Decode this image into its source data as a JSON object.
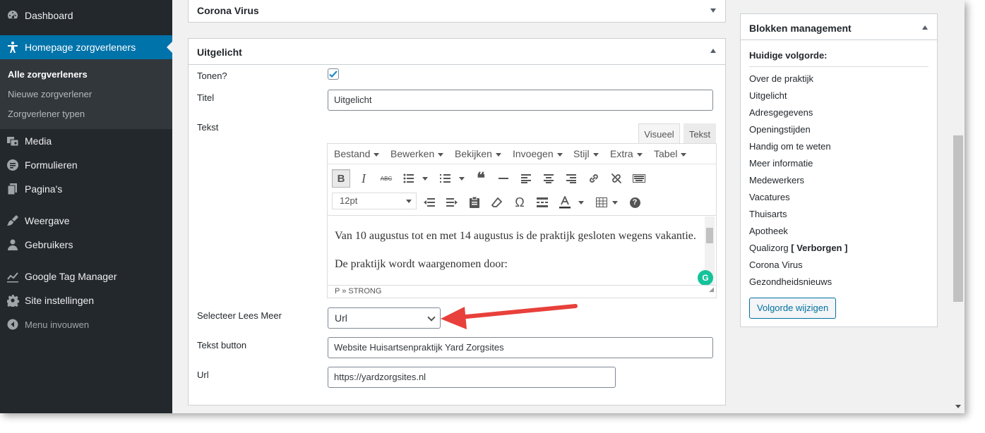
{
  "sidebar": {
    "items": [
      {
        "label": "Dashboard",
        "icon": "dashboard-icon"
      },
      {
        "label": "Homepage zorgverleners",
        "icon": "accessibility-icon"
      },
      {
        "label": "Media",
        "icon": "media-icon"
      },
      {
        "label": "Formulieren",
        "icon": "forms-icon"
      },
      {
        "label": "Pagina's",
        "icon": "pages-icon"
      },
      {
        "label": "Weergave",
        "icon": "appearance-icon"
      },
      {
        "label": "Gebruikers",
        "icon": "users-icon"
      },
      {
        "label": "Google Tag Manager",
        "icon": "chart-icon"
      },
      {
        "label": "Site instellingen",
        "icon": "gear-icon"
      }
    ],
    "submenu": [
      "Alle zorgverleners",
      "Nieuwe zorgverlener",
      "Zorgverlener typen"
    ],
    "collapse_label": "Menu invouwen"
  },
  "boxes": {
    "corona_title": "Corona Virus",
    "featured_title": "Uitgelicht"
  },
  "form": {
    "show_label": "Tonen?",
    "show_checked": true,
    "title_label": "Titel",
    "title_value": "Uitgelicht",
    "text_label": "Tekst",
    "read_more_label": "Selecteer Lees Meer",
    "read_more_value": "Url",
    "button_text_label": "Tekst button",
    "button_text_value": "Website Huisartsenpraktijk Yard Zorgsites",
    "url_label": "Url",
    "url_value": "https://yardzorgsites.nl"
  },
  "editor": {
    "tab_visual": "Visueel",
    "tab_text": "Tekst",
    "menu": [
      "Bestand",
      "Bewerken",
      "Bekijken",
      "Invoegen",
      "Stijl",
      "Extra",
      "Tabel"
    ],
    "bold_glyph": "B",
    "italic_glyph": "I",
    "strike_glyph": "ABC",
    "quote_glyph": "❝",
    "omega_glyph": "Ω",
    "help_glyph": "?",
    "font_size": "12pt",
    "paragraphs": [
      "Van 10 augustus tot en met 14 augustus is de praktijk gesloten wegens vakantie.",
      "De praktijk wordt waargenomen door:"
    ],
    "status_path": "P » STRONG",
    "grammarly_glyph": "G"
  },
  "blocks": {
    "title": "Blokken management",
    "heading": "Huidige volgorde:",
    "items": [
      "Over de praktijk",
      "Uitgelicht",
      "Adresgegevens",
      "Openingstijden",
      "Handig om te weten",
      "Meer informatie",
      "Medewerkers",
      "Vacatures",
      "Thuisarts",
      "Apotheek",
      "Qualizorg",
      "Corona Virus",
      "Gezondheidsnieuws"
    ],
    "hidden_item_suffix": "[ Verborgen ]",
    "button_label": "Volgorde wijzigen"
  },
  "colors": {
    "sidebar_bg": "#23282d",
    "active_menu": "#0073aa",
    "arrow_annotation": "#e8403b",
    "checkmark": "#1e8cbe"
  }
}
